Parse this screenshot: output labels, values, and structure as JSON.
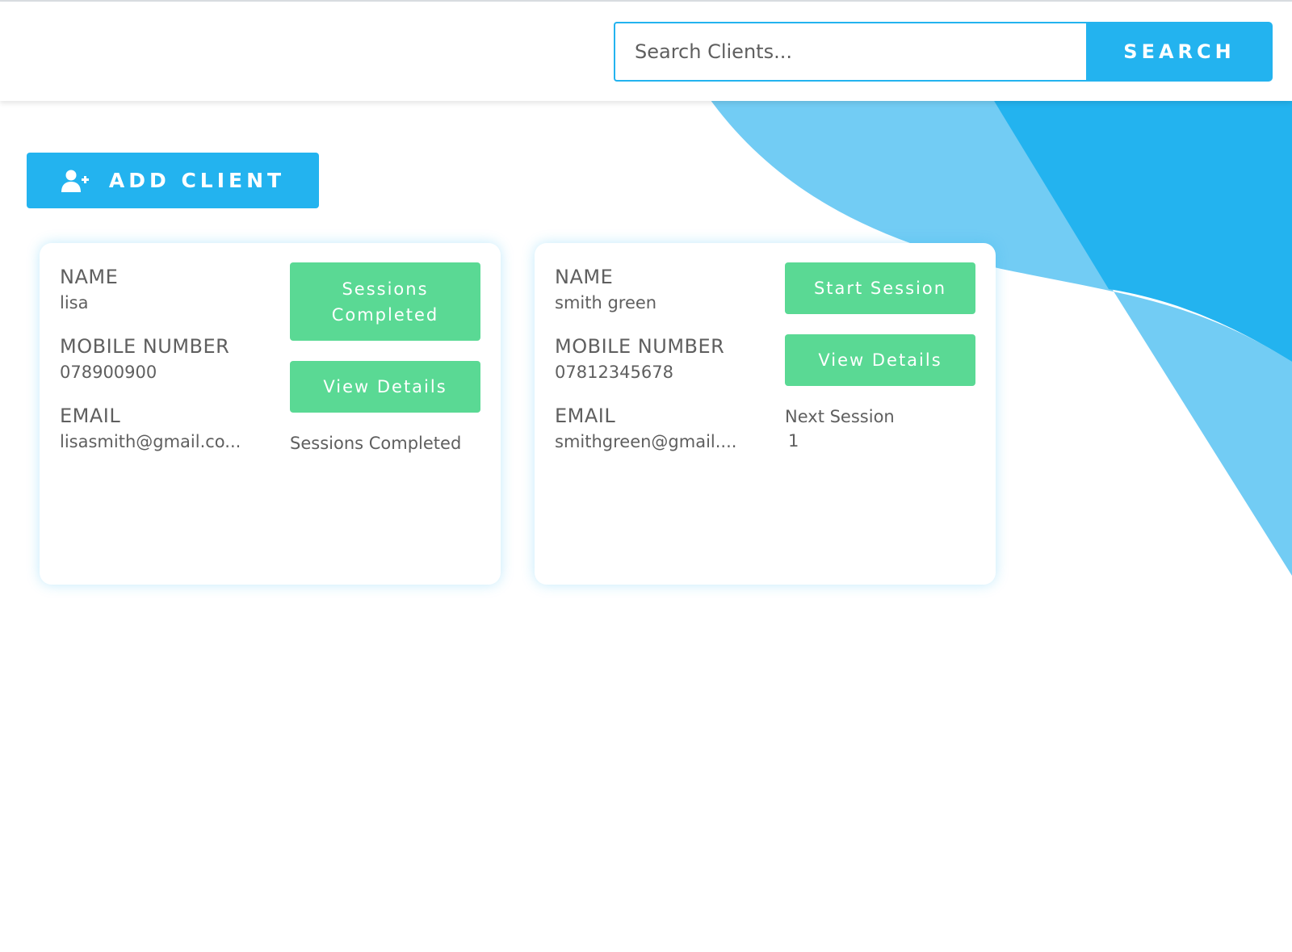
{
  "search": {
    "placeholder": "Search Clients...",
    "button_label": "SEARCH"
  },
  "toolbar": {
    "add_client_label": "ADD CLIENT",
    "add_client_icon": "user-plus-icon"
  },
  "colors": {
    "accent_blue": "#23b3ef",
    "light_blue": "#72ccf4",
    "success_green": "#5ad994",
    "text_gray": "#5f5f5f"
  },
  "clients": [
    {
      "name_label": "NAME",
      "name": "lisa",
      "mobile_label": "MOBILE NUMBER",
      "mobile": "078900900",
      "email_label": "EMAIL",
      "email": "lisasmith@gmail.co...",
      "primary_button": "Sessions Completed",
      "details_button": "View Details",
      "status_text": "Sessions Completed"
    },
    {
      "name_label": "NAME",
      "name": "smith green",
      "mobile_label": "MOBILE NUMBER",
      "mobile": "07812345678",
      "email_label": "EMAIL",
      "email": "smithgreen@gmail....",
      "primary_button": "Start Session",
      "details_button": "View Details",
      "next_session_label": "Next Session",
      "next_session_value": "1"
    }
  ]
}
